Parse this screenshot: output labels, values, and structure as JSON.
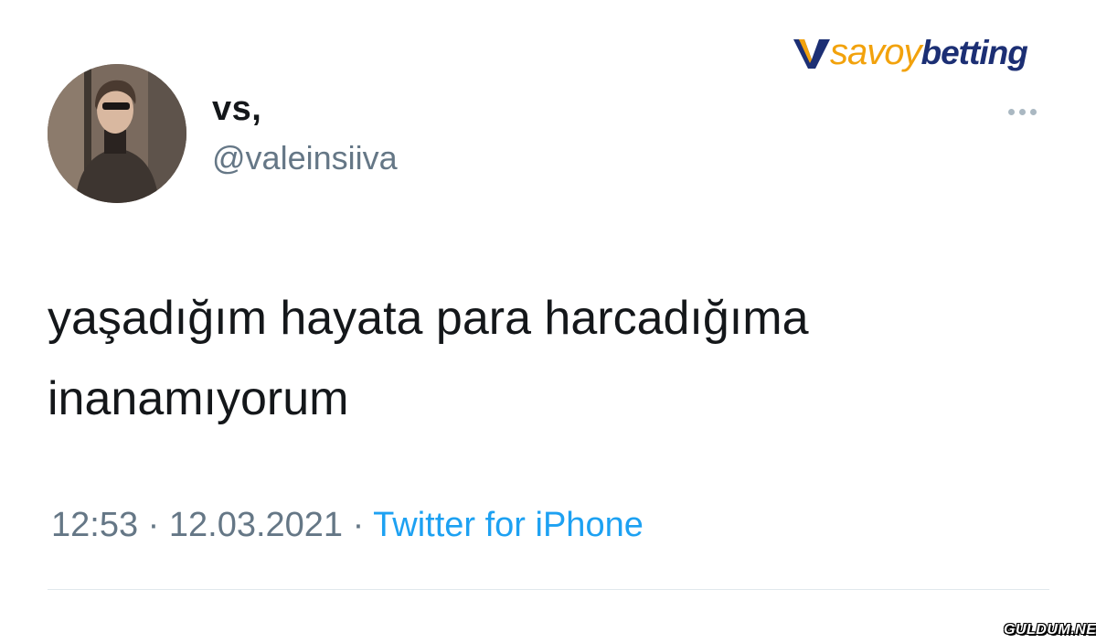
{
  "watermark": {
    "brand": "savoy",
    "suffix": "betting",
    "site": "GULDUM.NET"
  },
  "tweet": {
    "display_name": "vs,",
    "handle": "@valeinsiiva",
    "text_lines": [
      "yaşadığım hayata para harcadığıma",
      "inanamıyorum"
    ],
    "time": "12:53",
    "separator": "·",
    "date": "12.03.2021",
    "source": "Twitter for iPhone"
  },
  "icons": {
    "more": "more-horizontal-icon",
    "logo": "savoybetting-v-icon"
  },
  "colors": {
    "text": "#14171a",
    "secondary": "#657786",
    "link": "#1da1f2",
    "brand_gold": "#f2a20c",
    "brand_navy": "#1c2f74"
  }
}
